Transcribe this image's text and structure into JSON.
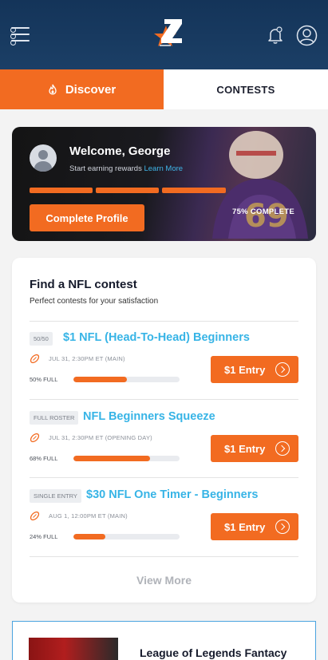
{
  "header": {
    "menu_icon": "menu-icon",
    "logo_icon": "z-star-logo",
    "notification_icon": "bell-icon",
    "profile_icon": "user-circle-icon"
  },
  "tabs": [
    {
      "label": "Discover",
      "icon": "flame-icon",
      "active": true
    },
    {
      "label": "CONTESTS",
      "active": false
    }
  ],
  "welcome": {
    "title": "Welcome, George",
    "subtitle": "Start earning rewards",
    "link": "Learn More",
    "button": "Complete Profile",
    "progress_label": "75% COMPLETE",
    "progress_fraction": 0.75
  },
  "contests": {
    "title": "Find a NFL contest",
    "subtitle": "Perfect contests for your satisfaction",
    "items": [
      {
        "badge": "50/50",
        "name": "$1 NFL (Head-To-Head) Beginners",
        "date": "JUL 31, 2:30PM ET (MAIN)",
        "full_label": "50% FULL",
        "fill": 0.5,
        "button": "$1 Entry"
      },
      {
        "badge": "FULL ROSTER",
        "name": "NFL Beginners Squeeze",
        "date": "JUL 31, 2:30PM ET (OPENING DAY)",
        "full_label": "68% FULL",
        "fill": 0.72,
        "button": "$1 Entry"
      },
      {
        "badge": "SINGLE ENTRY",
        "name": "$30 NFL One Timer - Beginners",
        "date": "AUG 1, 12:00PM ET (MAIN)",
        "full_label": "24% FULL",
        "fill": 0.3,
        "button": "$1 Entry"
      }
    ],
    "view_more": "View More"
  },
  "promo": {
    "title": "League of Legends Fantacy"
  },
  "colors": {
    "accent": "#f26b21",
    "link_blue": "#37b4e6",
    "header_navy": "#143459"
  }
}
